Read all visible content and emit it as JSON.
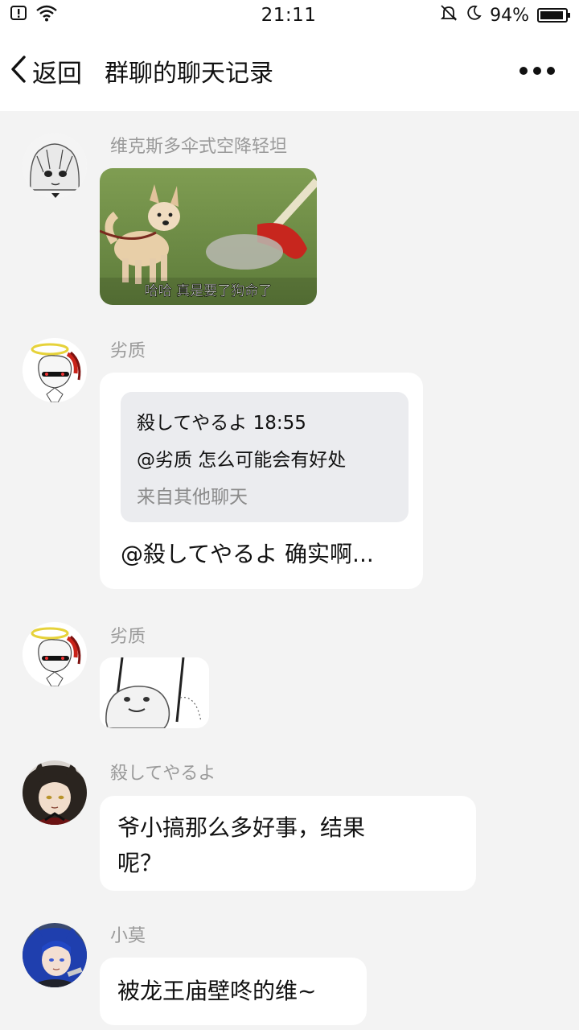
{
  "status_bar": {
    "time": "21:11",
    "battery_percent": "94%",
    "battery_level": 0.94
  },
  "header": {
    "back_label": "返回",
    "title": "群聊的聊天记录"
  },
  "messages": [
    {
      "sender": "维克斯多伞式空降轻坦",
      "type": "image",
      "image_caption": "哈哈 真是要了狗命了"
    },
    {
      "sender": "劣质",
      "type": "reply",
      "quote": {
        "author_time": "殺してやるよ 18:55",
        "text": "@劣质 怎么可能会有好处",
        "source": "来自其他聊天"
      },
      "text": "@殺してやるよ 确实啊..."
    },
    {
      "sender": "劣质",
      "type": "sticker"
    },
    {
      "sender": "殺してやるよ",
      "type": "text",
      "text_line1": "爷小搞那么多好事，结果",
      "text_line2": "呢？"
    },
    {
      "sender": "小莫",
      "type": "text",
      "text": "被龙王庙壁咚的维~"
    }
  ]
}
